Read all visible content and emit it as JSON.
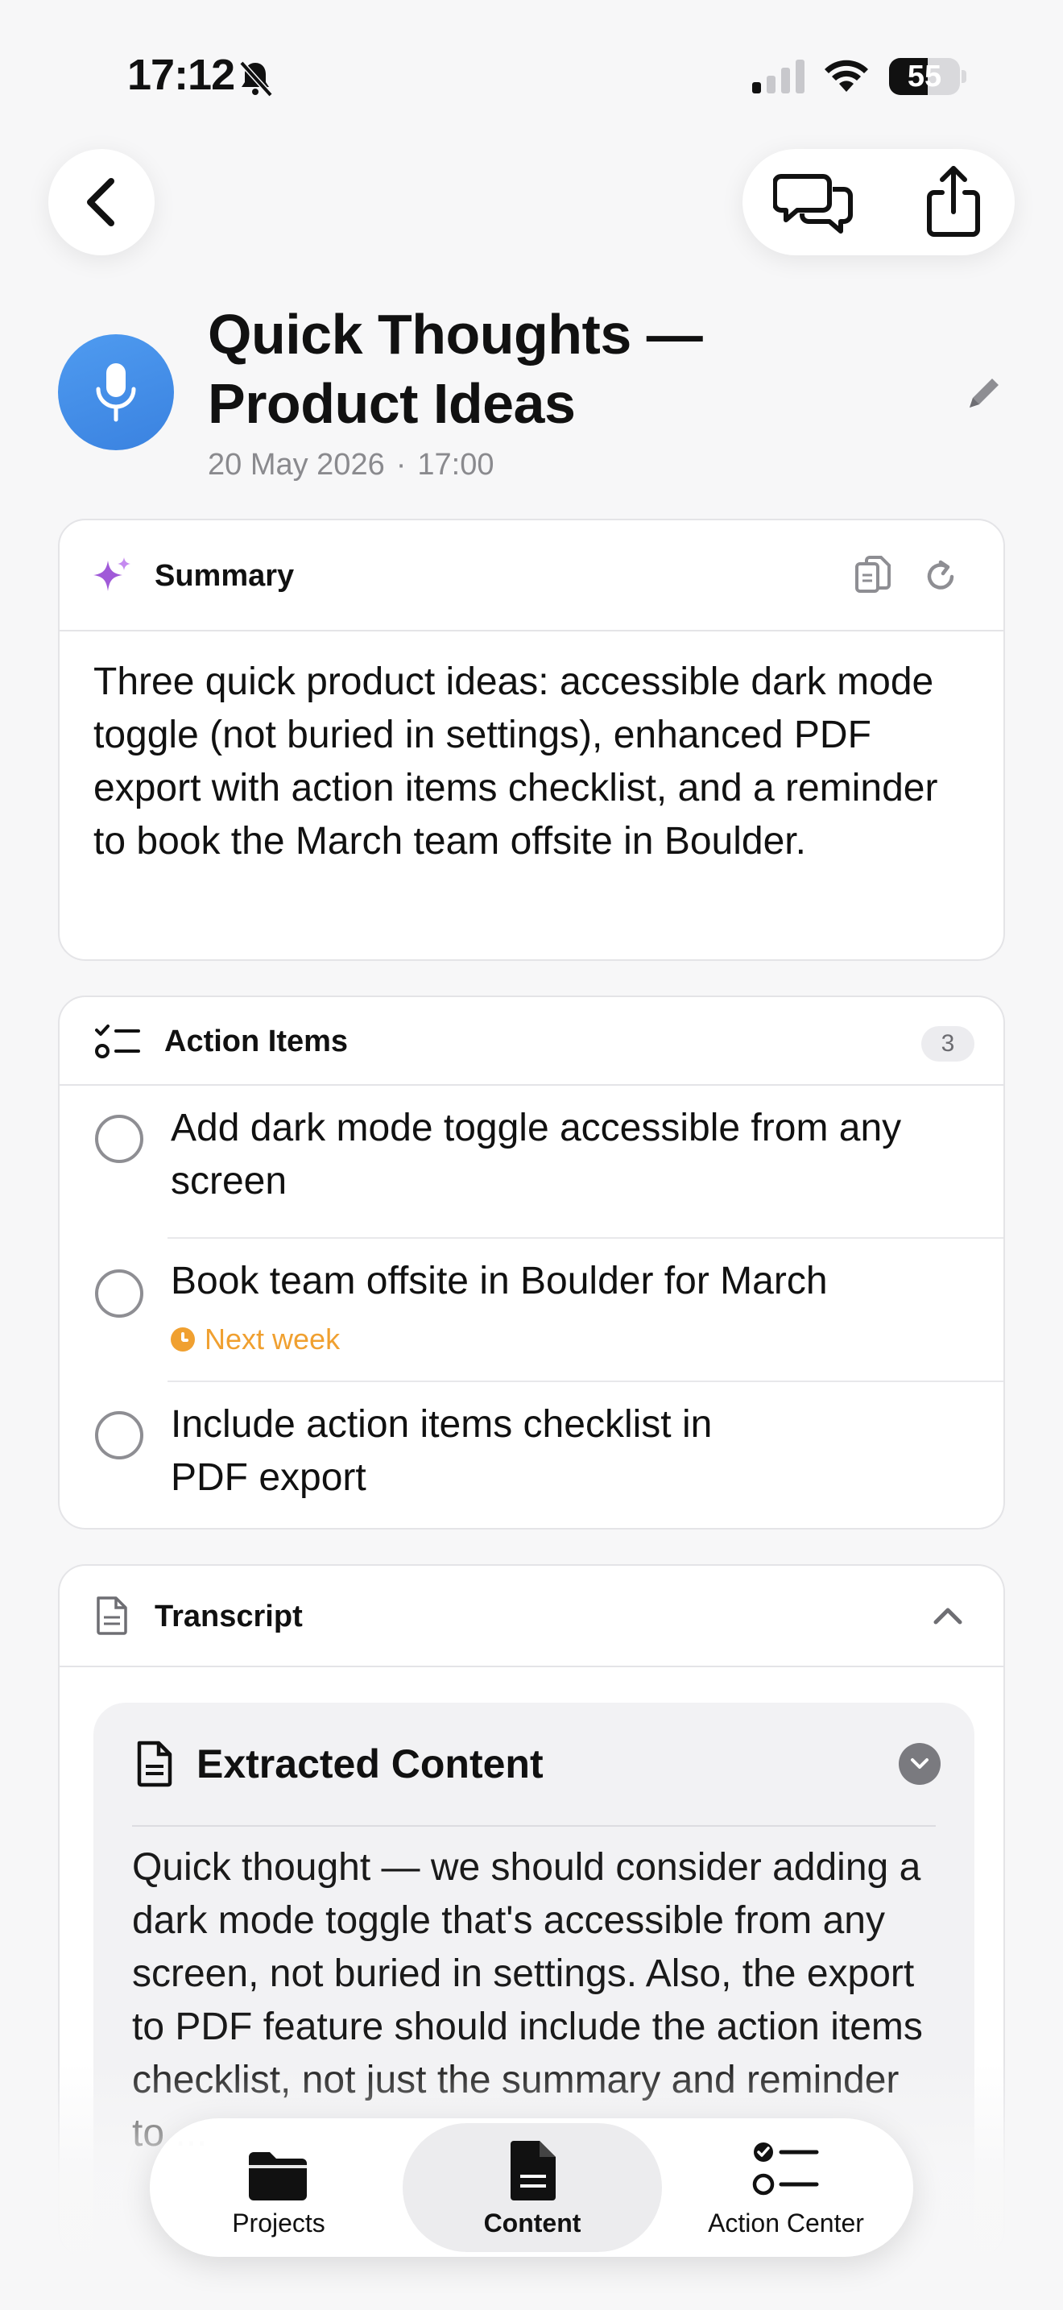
{
  "status_bar": {
    "time": "17:12",
    "battery": "55",
    "battery_level": 0.55
  },
  "header": {
    "title_line1": "Quick Thoughts —",
    "title_line2": "Product Ideas",
    "date": "20 May 2026",
    "separator": "·",
    "time": "17:00"
  },
  "summary": {
    "title": "Summary",
    "text": "Three quick product ideas: accessible dark mode toggle (not buried in settings), enhanced PDF export with action items checklist, and a reminder to book the March team offsite in Boulder."
  },
  "action_items": {
    "title": "Action Items",
    "count": "3",
    "items": [
      {
        "text": "Add dark mode toggle accessible from any screen",
        "due": ""
      },
      {
        "text": "Book team offsite in Boulder for March",
        "due": "Next week"
      },
      {
        "text": "Include action items checklist in PDF export",
        "due": ""
      }
    ]
  },
  "transcript": {
    "title": "Transcript",
    "extracted_title": "Extracted Content",
    "extracted_text": "Quick thought — we should consider adding a dark mode toggle that's accessible from any screen, not buried in settings. Also, the export to PDF feature should include the action items checklist, not just the summary and reminder to ..."
  },
  "tabbar": {
    "tabs": [
      {
        "label": "Projects",
        "icon": "folder-icon"
      },
      {
        "label": "Content",
        "icon": "document-icon",
        "selected": true
      },
      {
        "label": "Action Center",
        "icon": "checklist-icon"
      }
    ]
  },
  "colors": {
    "accent_blue": "#3a82e0",
    "due_orange": "#f0a030",
    "spark_purple": "#a05ad8"
  }
}
